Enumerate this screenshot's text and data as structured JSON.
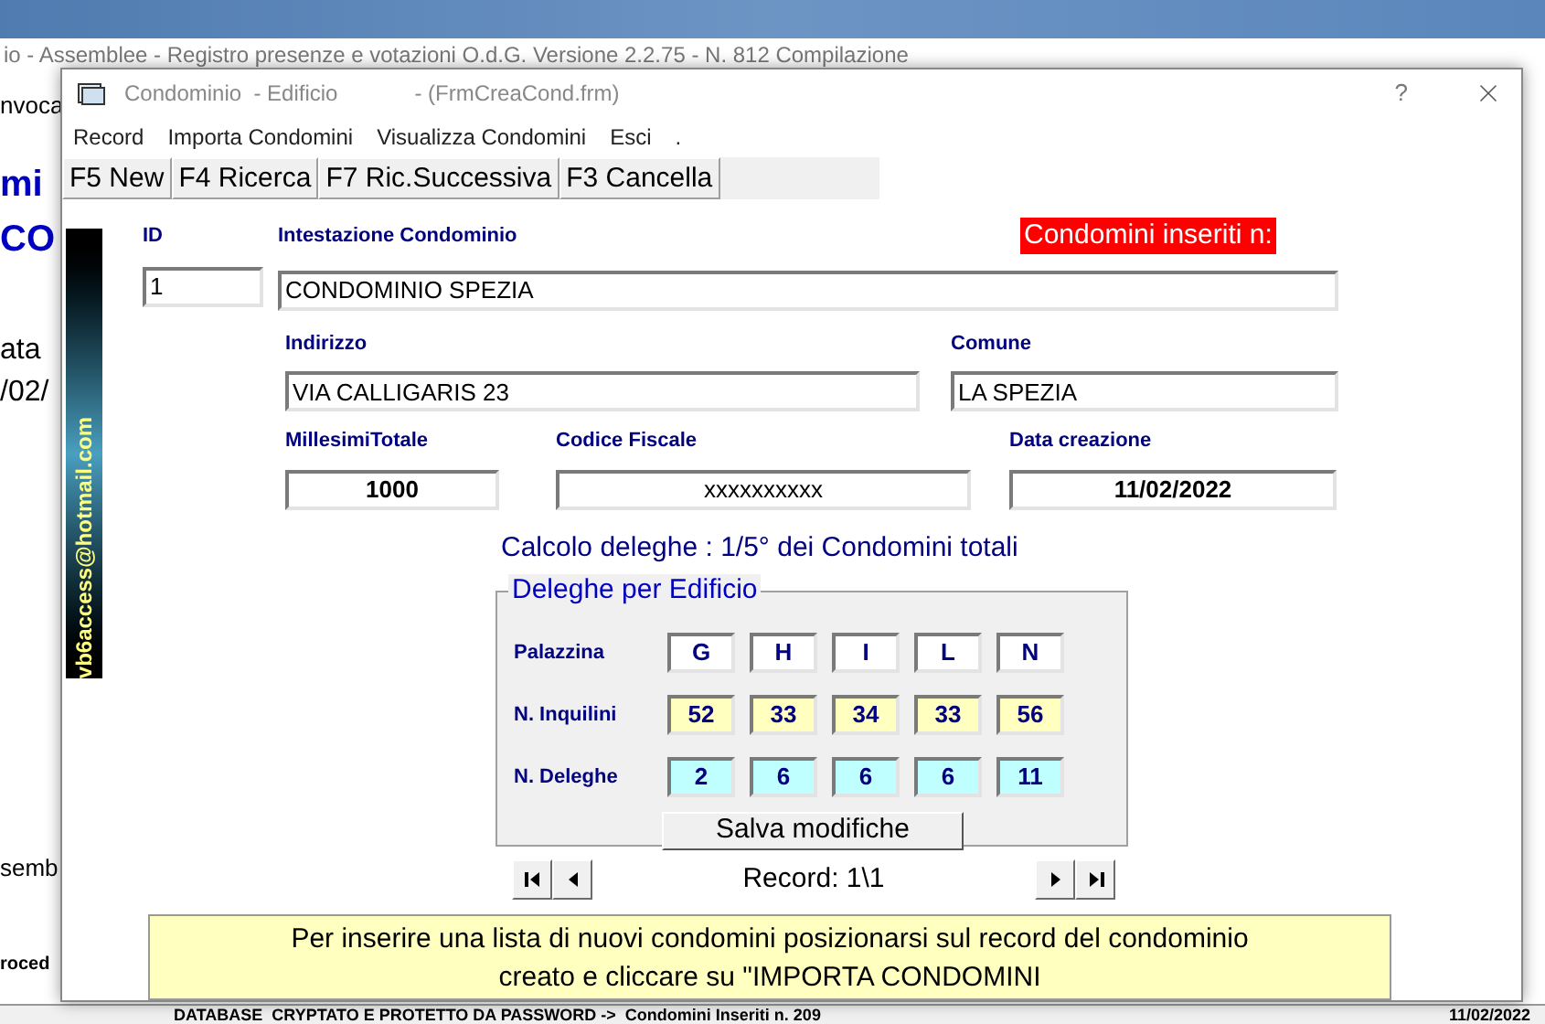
{
  "background_window": {
    "title": "io - Assemblee - Registro presenze e votazioni O.d.G. Versione 2.2.75 - N. 812 Compilazione",
    "fragments": [
      {
        "text": "nvoca",
        "kind": "small"
      },
      {
        "text": "mi",
        "kind": "big"
      },
      {
        "text": "CO",
        "kind": "big"
      },
      {
        "text": "ata",
        "kind": "cell"
      },
      {
        "text": "/02/",
        "kind": "cell"
      },
      {
        "text": "semb",
        "kind": "small"
      },
      {
        "text": "roced",
        "kind": "tiny"
      }
    ],
    "status_bar": {
      "message": "DATABASE  CRYPTATO E PROTETTO DA PASSWORD ->  Condomini Inseriti n. 209",
      "date": "11/02/2022"
    }
  },
  "dialog": {
    "title": "Condominio  - Edificio",
    "form_name": "- (FrmCreaCond.frm)",
    "help": "?"
  },
  "menu": [
    "Record",
    "Importa Condomini",
    "Visualizza Condomini",
    "Esci",
    "."
  ],
  "toolbar": [
    "F5 New",
    "F4 Ricerca",
    "F7 Ric.Successiva",
    "F3 Cancella"
  ],
  "side_banner": "vb6access@hotmail.com",
  "counter_label": "Condomini inseriti n:",
  "fields": {
    "id": {
      "label": "ID",
      "value": "1"
    },
    "intestazione": {
      "label": "Intestazione Condominio",
      "value": "CONDOMINIO SPEZIA"
    },
    "indirizzo": {
      "label": "Indirizzo",
      "value": "VIA CALLIGARIS 23"
    },
    "comune": {
      "label": "Comune",
      "value": "LA SPEZIA"
    },
    "millesimi": {
      "label": "MillesimiTotale",
      "value": "1000"
    },
    "codice_fiscale": {
      "label": "Codice Fiscale",
      "value": "xxxxxxxxxx"
    },
    "data_creazione": {
      "label": "Data creazione",
      "value": "11/02/2022"
    }
  },
  "deleghe": {
    "summary": "Calcolo deleghe : 1/5° dei Condomini totali",
    "title": "Deleghe per Edificio",
    "rows": [
      {
        "label": "Palazzina",
        "kind": "header",
        "cells": [
          "G",
          "H",
          "I",
          "L",
          "N"
        ]
      },
      {
        "label": "N. Inquilini",
        "kind": "inquilini",
        "cells": [
          "52",
          "33",
          "34",
          "33",
          "56"
        ]
      },
      {
        "label": "N. Deleghe",
        "kind": "deleghe",
        "cells": [
          "2",
          "6",
          "6",
          "6",
          "11"
        ]
      }
    ],
    "button": "Salva modifiche"
  },
  "navigator": {
    "text": "Record: 1\\1"
  },
  "note": [
    "Per inserire una lista di nuovi condomini posizionarsi sul record del condominio",
    "creato e cliccare su \"IMPORTA CONDOMINI"
  ]
}
